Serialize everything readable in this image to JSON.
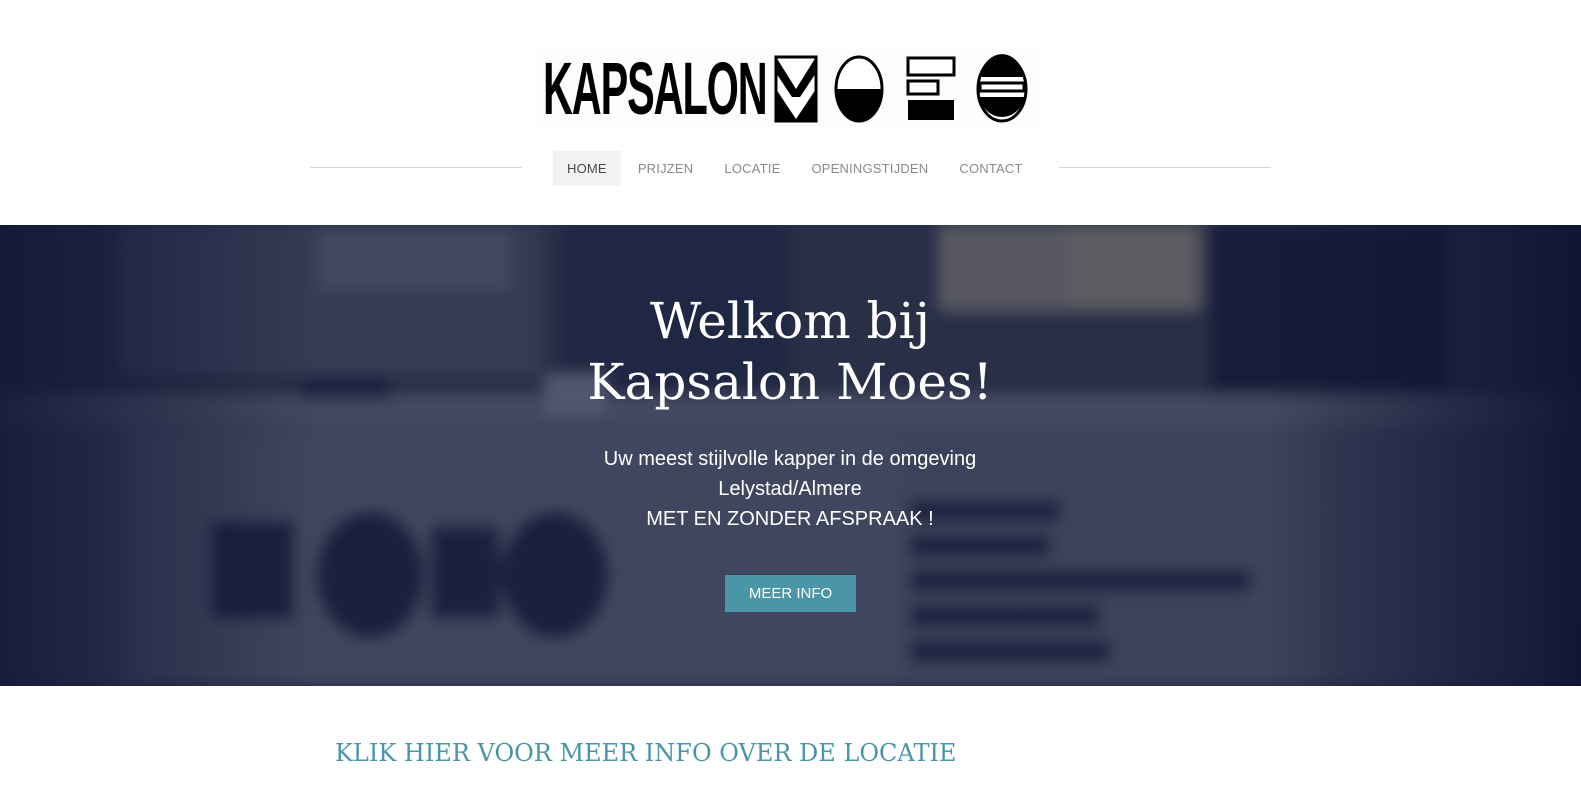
{
  "header": {
    "logo_text": "KAPSALON",
    "logo_mark_letters": "MOES"
  },
  "nav": {
    "items": [
      {
        "label": "HOME",
        "active": true
      },
      {
        "label": "PRIJZEN",
        "active": false
      },
      {
        "label": "LOCATIE",
        "active": false
      },
      {
        "label": "OPENINGSTIJDEN",
        "active": false
      },
      {
        "label": "CONTACT",
        "active": false
      }
    ]
  },
  "hero": {
    "title_line1": "Welkom bij",
    "title_line2": "Kapsalon Moes!",
    "subtitle_line1": "Uw meest stijlvolle kapper in de omgeving",
    "subtitle_line2": "Lelystad/Almere",
    "subtitle_line3": "MET EN ZONDER AFSPRAAK !",
    "button_label": "MEER INFO"
  },
  "content": {
    "location_link": "KLIK HIER VOOR MEER INFO OVER DE LOCATIE"
  },
  "colors": {
    "accent": "#4a96a6",
    "nav_active_bg": "#f2f2f2",
    "nav_text": "#8a8a8a",
    "hero_overlay": "#1a1f3a"
  }
}
